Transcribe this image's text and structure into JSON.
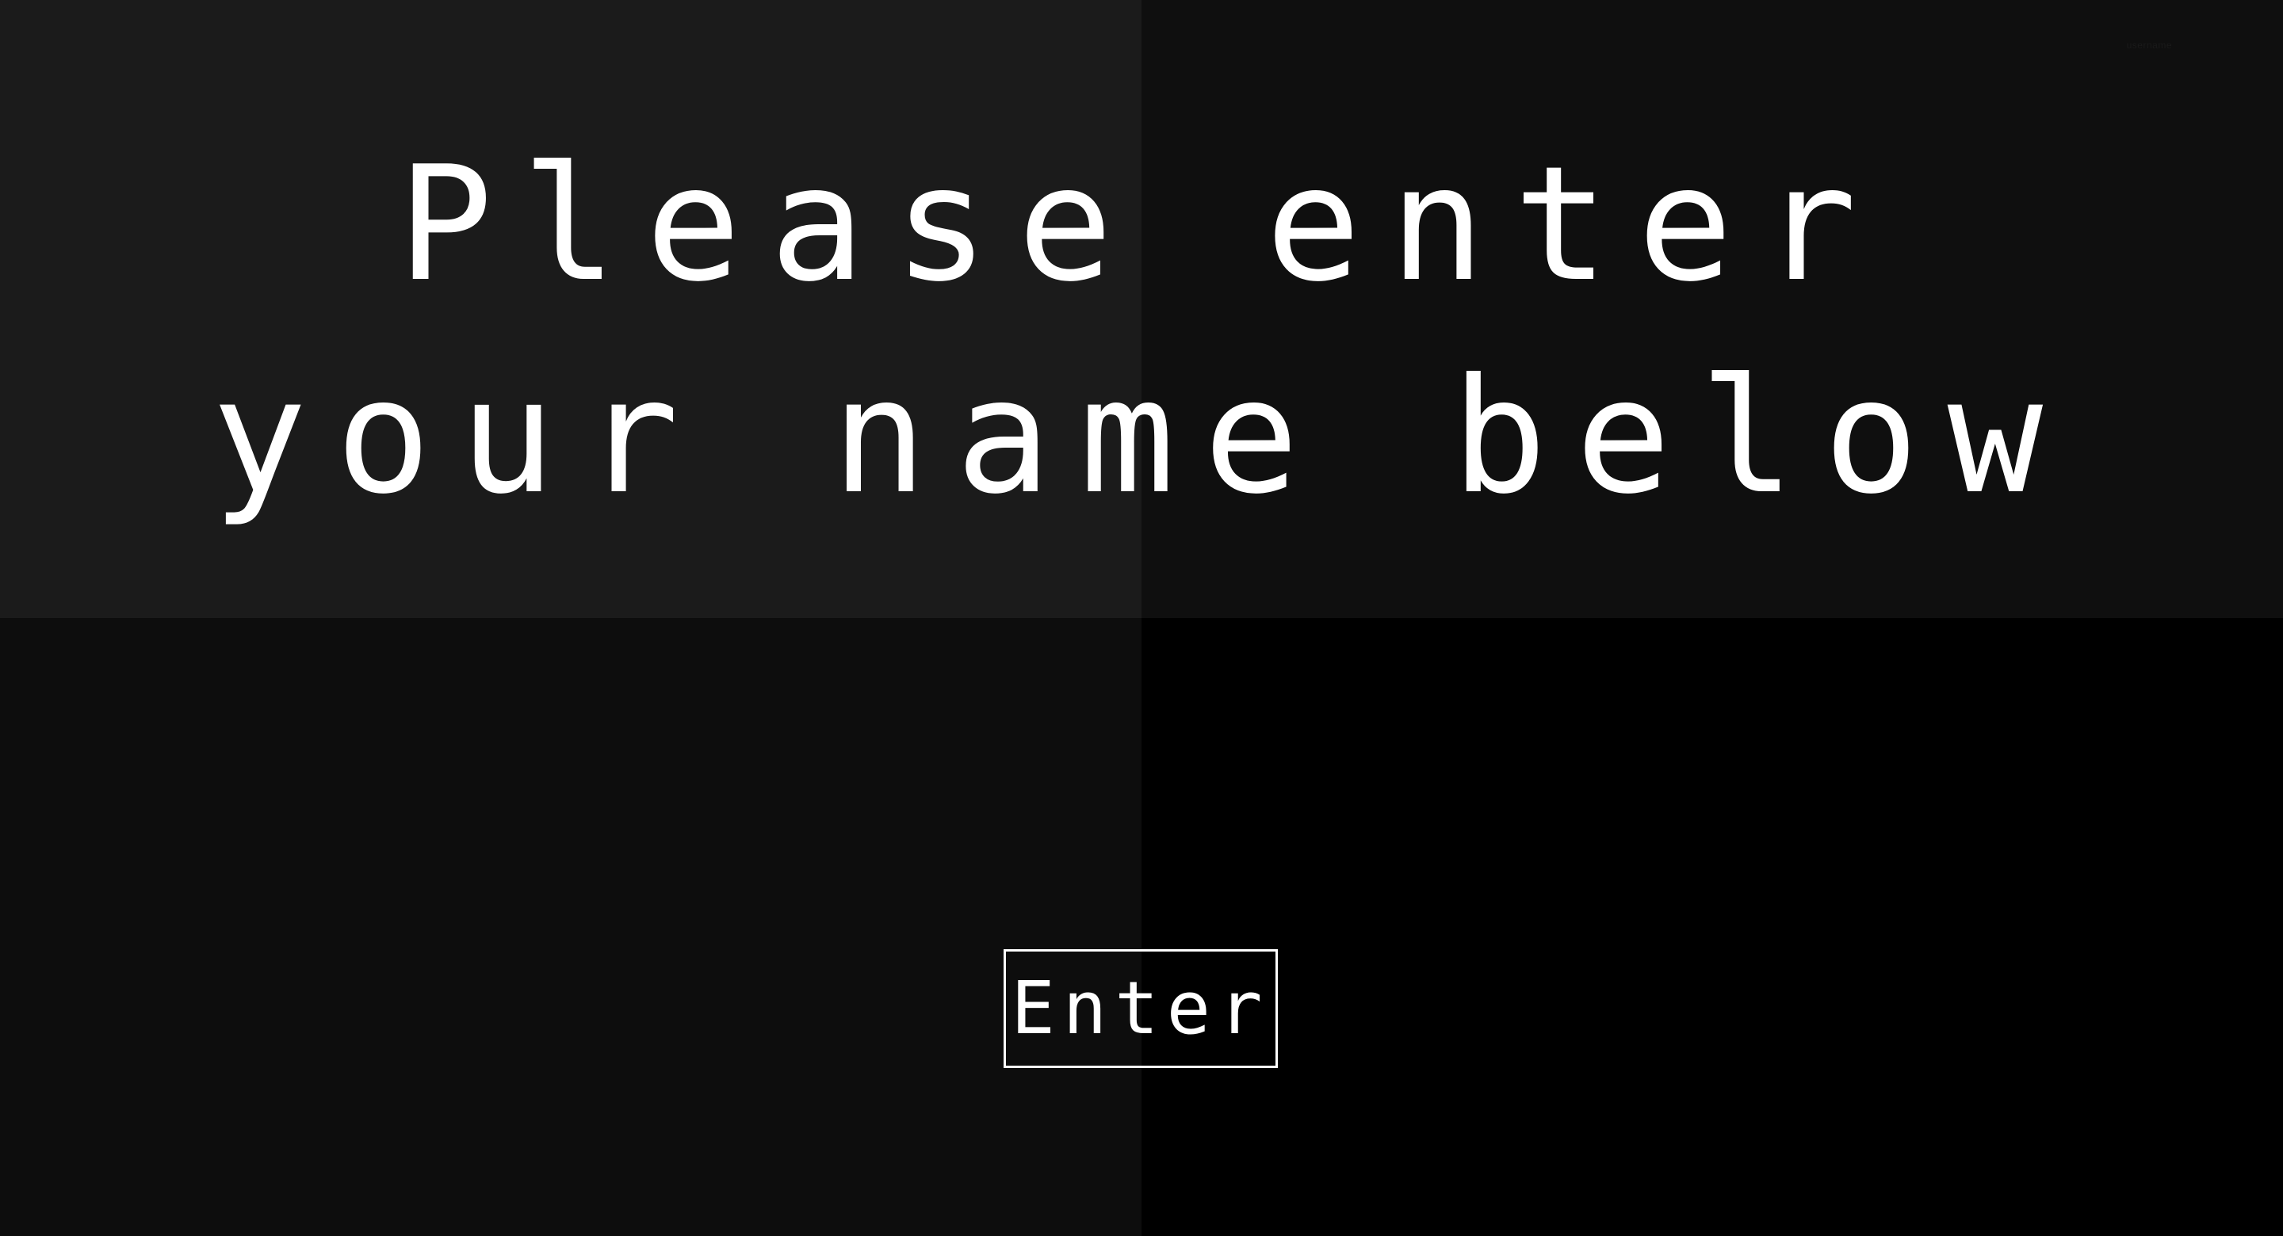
{
  "corner_label": "username",
  "prompt": {
    "line1": "Please enter",
    "line2": "your name below"
  },
  "enter_button": {
    "label": "Enter"
  },
  "colors": {
    "quadrant_top_left": "#1b1b1b",
    "quadrant_top_right": "#0f0f0f",
    "quadrant_bottom_left": "#0d0d0d",
    "quadrant_bottom_right": "#000000",
    "text": "#ffffff"
  }
}
